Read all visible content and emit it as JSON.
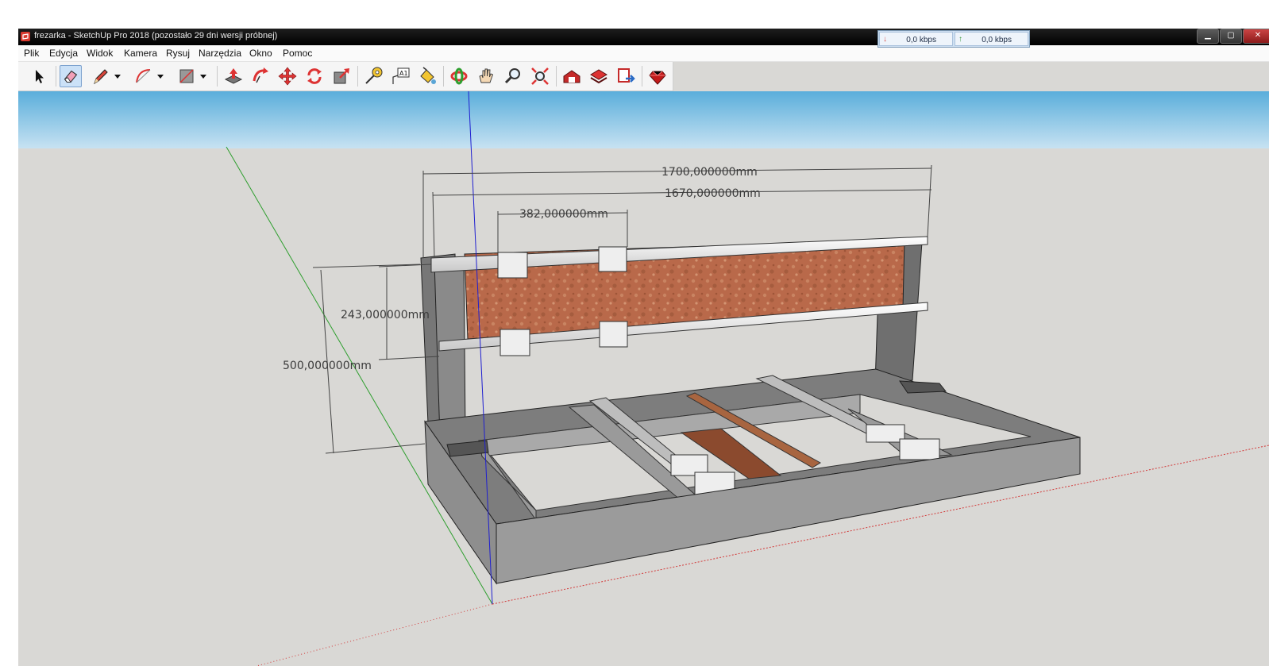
{
  "window": {
    "title": "frezarka - SketchUp Pro 2018 (pozostało 29 dni wersji próbnej)",
    "controls": {
      "minimize": "▁",
      "maximize": "▢",
      "close": "✕"
    }
  },
  "netmonitor": {
    "download": "0,0 kbps",
    "upload": "0,0 kbps",
    "download_color": "#d9534f",
    "upload_color": "#3c9a3c"
  },
  "menu": [
    "Plik",
    "Edycja",
    "Widok",
    "Kamera",
    "Rysuj",
    "Narzędzia",
    "Okno",
    "Pomoc"
  ],
  "toolbar": {
    "tools": [
      "select-arrow-icon",
      "eraser-icon",
      "pencil-line-icon",
      "arc-icon",
      "rectangle-icon",
      "push-pull-icon",
      "follow-me-icon",
      "move-icon",
      "rotate-icon",
      "scale-icon",
      "tape-measure-icon",
      "text-label-icon",
      "paint-bucket-icon",
      "orbit-icon",
      "pan-hand-icon",
      "zoom-icon",
      "zoom-extents-icon",
      "warehouse-icon",
      "extension-warehouse-icon",
      "send-to-layout-icon",
      "ruby-console-icon"
    ],
    "active": "eraser-icon",
    "text_tool_glyph": "A1"
  },
  "dimensions": {
    "overall_length": "1700,000000mm",
    "inner_length": "1670,000000mm",
    "carriage_spacing": "382,000000mm",
    "rail_spacing": "243,000000mm",
    "gantry_height": "500,000000mm"
  },
  "colors": {
    "sky_top": "#5aaedb",
    "ground": "#d9d8d5",
    "frame_gray": "#8f8f8f",
    "panel_wood": "#b9694a",
    "axis_red": "#d23a3a",
    "axis_green": "#2e9e2e",
    "axis_blue": "#1f1fd0"
  }
}
